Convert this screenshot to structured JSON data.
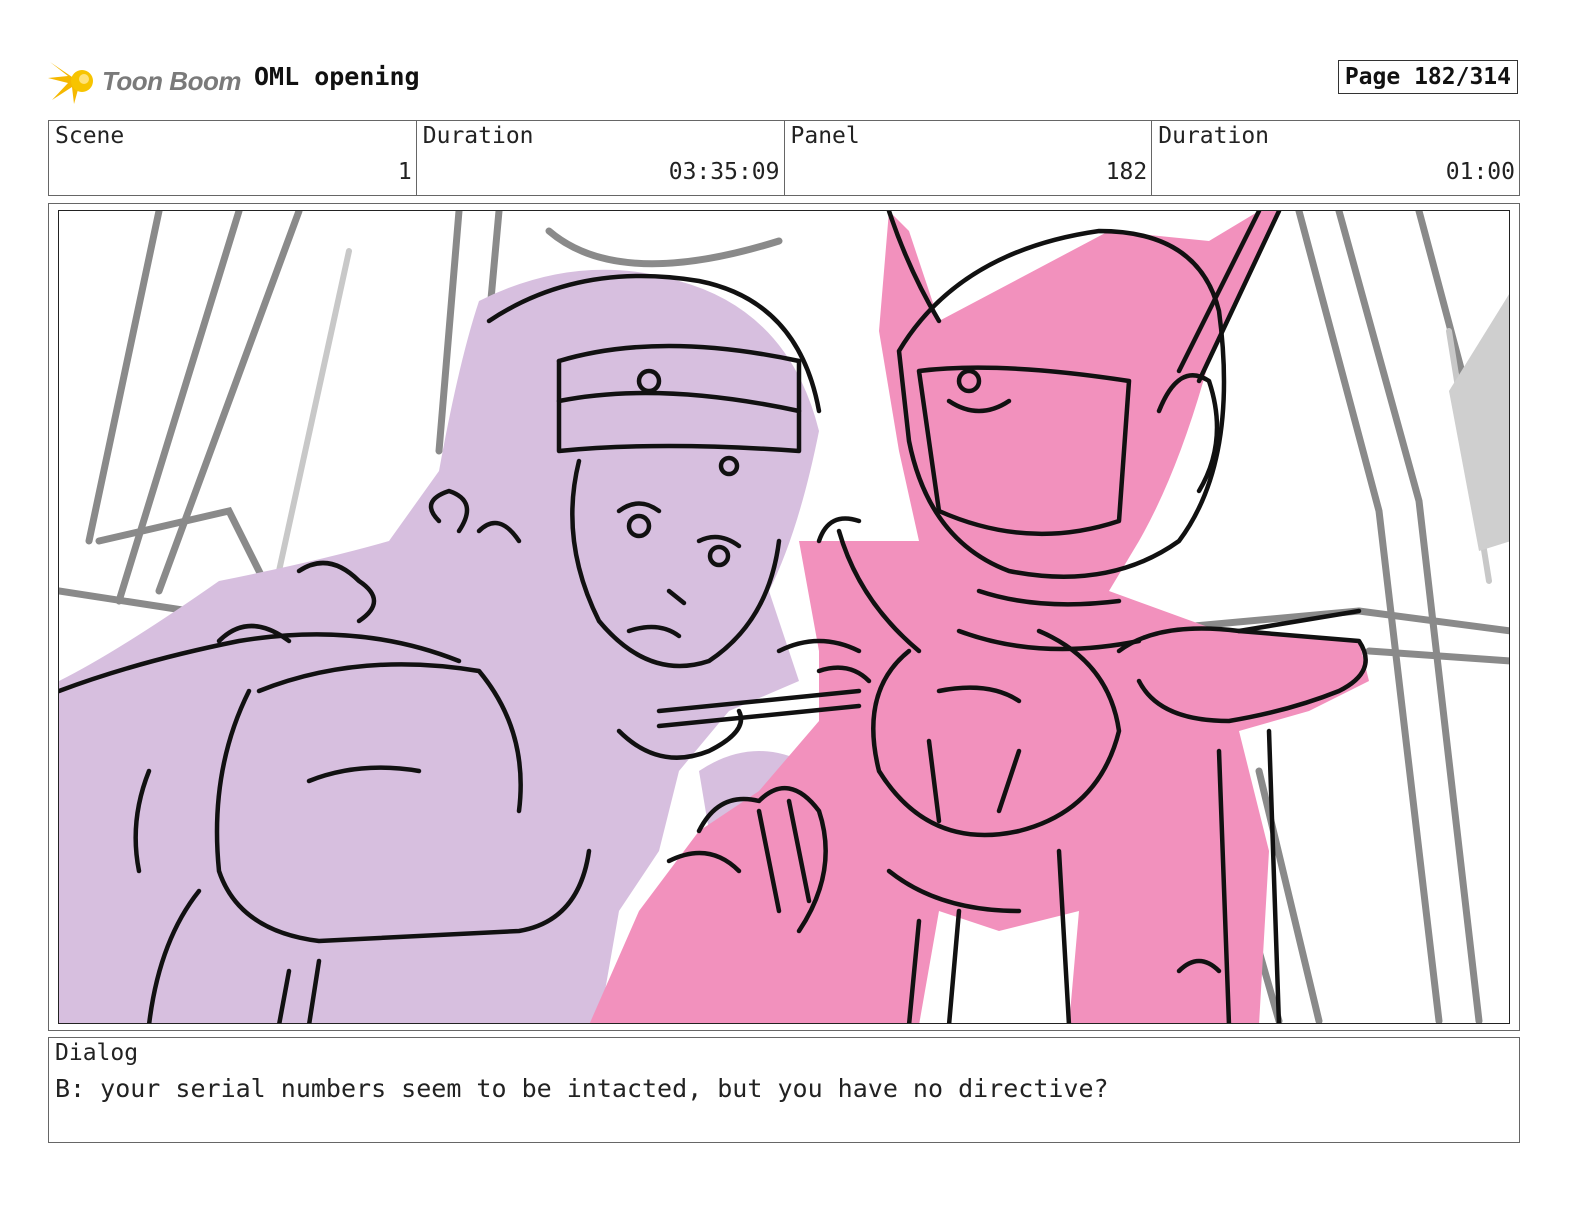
{
  "header": {
    "logo_text": "Toon Boom",
    "project_title": "OML opening",
    "page_label": "Page 182/314"
  },
  "info": {
    "scene_label": "Scene",
    "scene_value": "1",
    "duration_label": "Duration",
    "duration_value": "03:35:09",
    "panel_label": "Panel",
    "panel_value": "182",
    "panel_duration_label": "Duration",
    "panel_duration_value": "01:00"
  },
  "dialog": {
    "label": "Dialog",
    "text": "B: your serial numbers seem to be intacted, but you have no directive?"
  },
  "colors": {
    "girl_fill": "#d7bfdf",
    "robot_fill": "#f291bd",
    "background_lines": "#8a8a8a",
    "ink": "#111111",
    "logo_star": "#f5b800"
  },
  "icons": {
    "logo": "toon-boom-star-icon"
  }
}
